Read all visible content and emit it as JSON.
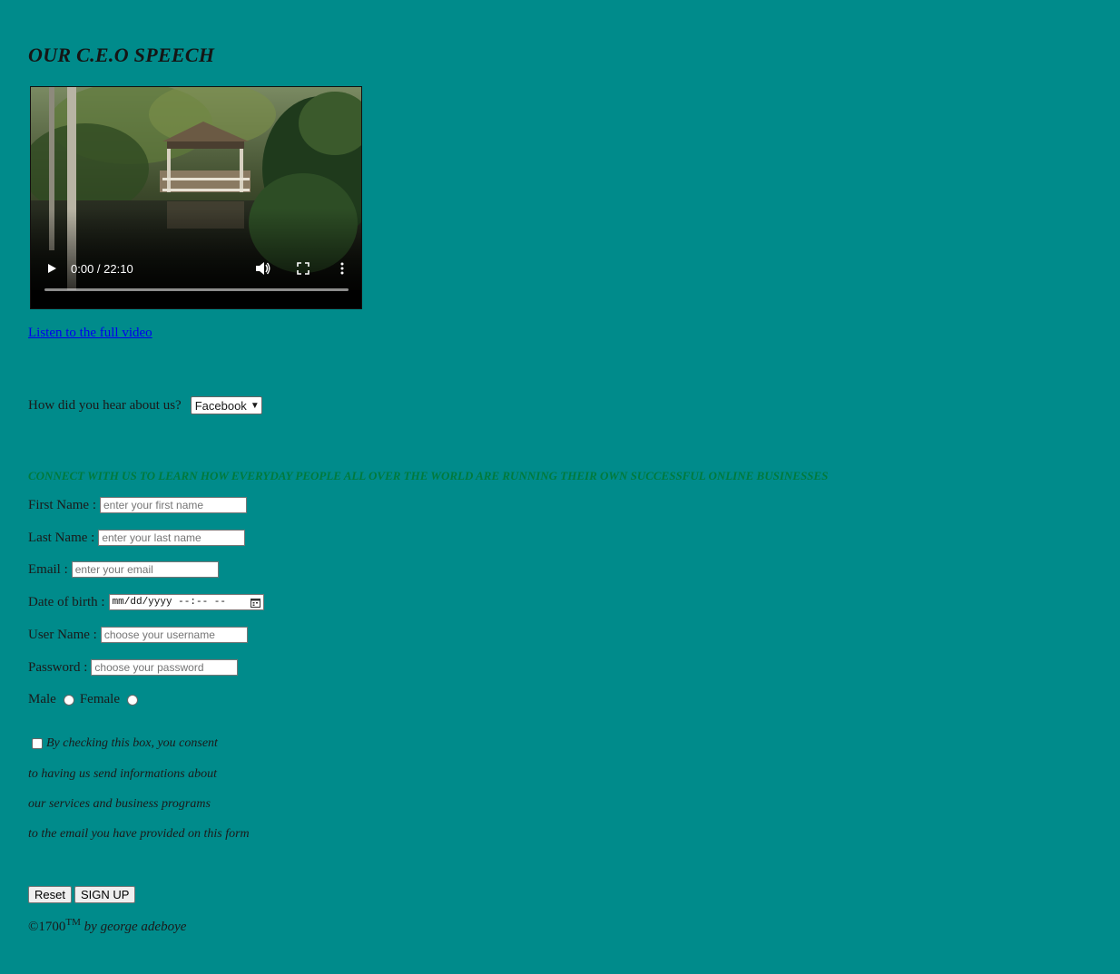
{
  "heading": "OUR C.E.O SPEECH",
  "video": {
    "time": "0:00 / 22:10",
    "play_icon": "play-icon",
    "volume_icon": "volume-icon",
    "fullscreen_icon": "fullscreen-icon",
    "more_icon": "more-options-icon",
    "progress": 0
  },
  "link_full_video": "Listen to the full video",
  "hear": {
    "label": "How did you hear about us?",
    "selected": "Facebook"
  },
  "connect_heading": "CONNECT WITH US TO LEARN HOW EVERYDAY PEOPLE ALL OVER THE WORLD ARE RUNNING THEIR OWN SUCCESSFUL ONLINE BUSINESSES",
  "form": {
    "first_name_label": "First Name :",
    "first_name_placeholder": "enter your first name",
    "last_name_label": "Last Name :",
    "last_name_placeholder": "enter your last name",
    "email_label": "Email :",
    "email_placeholder": "enter your email",
    "dob_label": "Date of birth :",
    "dob_placeholder": "mm/dd/yyyy --:-- --",
    "username_label": "User Name :",
    "username_placeholder": "choose your username",
    "password_label": "Password :",
    "password_placeholder": "choose your password",
    "male_label": "Male",
    "female_label": "Female"
  },
  "consent": {
    "line1": "By checking this box, you consent",
    "line2": "to having us send informations about",
    "line3": "our services and business programs",
    "line4": "to the email you have provided on this form"
  },
  "buttons": {
    "reset": "Reset",
    "signup": "SIGN UP"
  },
  "footer": {
    "copyright": "©1700",
    "tm": "TM",
    "by": "by george adeboye"
  },
  "colors": {
    "background": "#008b8b",
    "connect_heading": "#007a3d",
    "link": "#0000ee"
  }
}
